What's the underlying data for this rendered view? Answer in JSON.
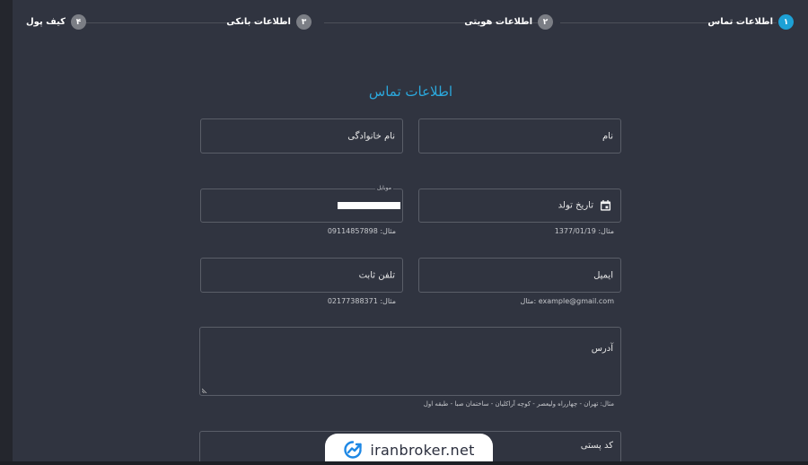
{
  "steps": [
    {
      "num": "۱",
      "label": "اطلاعات تماس",
      "active": true
    },
    {
      "num": "۲",
      "label": "اطلاعات هویتی",
      "active": false
    },
    {
      "num": "۳",
      "label": "اطلاعات بانکی",
      "active": false
    },
    {
      "num": "۴",
      "label": "کیف پول",
      "active": false
    }
  ],
  "form": {
    "title": "اطلاعات تماس",
    "first_name_label": "نام",
    "last_name_label": "نام خانوادگی",
    "birth_date_label": "تاریخ تولد",
    "birth_date_hint": "مثال: 1377/01/19",
    "mobile_floating_label": "موبایل",
    "mobile_hint": "مثال: 09114857898",
    "email_label": "ایمیل",
    "email_hint": "مثال: example@gmail.com",
    "landline_label": "تلفن ثابت",
    "landline_hint": "مثال: 02177388371",
    "address_label": "آدرس",
    "address_hint": "مثال: تهران - چهارراه ولیعصر - کوچه آراکلیان - ساختمان صبا - طبقه اول",
    "postal_label": "کد پستی"
  },
  "watermark": {
    "text": "iranbroker.net"
  },
  "icons": {
    "calendar": "calendar-icon",
    "watermark_logo": "trend-chart-icon"
  },
  "colors": {
    "background": "#303440",
    "accent": "#1da1d6",
    "inactive_step": "#7b7e85",
    "border": "#5a5e68"
  }
}
